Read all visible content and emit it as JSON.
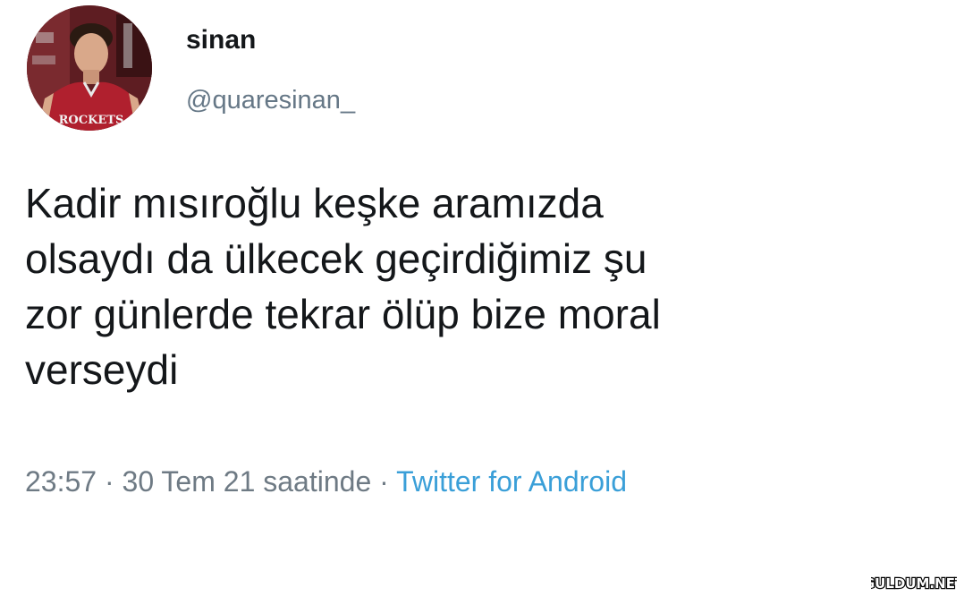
{
  "user": {
    "display_name": "sinan",
    "handle": "@quaresinan_",
    "avatar_jersey_text": "ROCKETS"
  },
  "tweet": {
    "text": "Kadir mısıroğlu keşke aramızda\nolsaydı da ülkecek geçirdiğimiz şu\nzor günlerde tekrar ölüp bize moral\nverseydi",
    "time": "23:57",
    "separator": "·",
    "date": "30 Tem 21 saatinde",
    "source": "Twitter for Android"
  },
  "watermark": {
    "text": "GULDUM.NET"
  },
  "colors": {
    "text": "#14171a",
    "secondary": "#657786",
    "link": "#3a9fd8",
    "jersey": "#b0202e"
  }
}
